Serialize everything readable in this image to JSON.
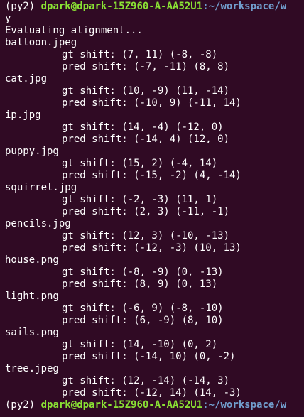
{
  "prompt_top": {
    "env": "(py2)",
    "user_host": "dpark@dpark-15Z960-A-AA52U1",
    "path": ":~/workspace/w"
  },
  "input_line": "y",
  "status": "Evaluating alignment...",
  "files": [
    {
      "name": "balloon.jpeg",
      "gt": "gt shift: (7, 11) (-8, -8)",
      "pred": "pred shift: (-7, -11) (8, 8)"
    },
    {
      "name": "cat.jpg",
      "gt": "gt shift: (10, -9) (11, -14)",
      "pred": "pred shift: (-10, 9) (-11, 14)"
    },
    {
      "name": "ip.jpg",
      "gt": "gt shift: (14, -4) (-12, 0)",
      "pred": "pred shift: (-14, 4) (12, 0)"
    },
    {
      "name": "puppy.jpg",
      "gt": "gt shift: (15, 2) (-4, 14)",
      "pred": "pred shift: (-15, -2) (4, -14)"
    },
    {
      "name": "squirrel.jpg",
      "gt": "gt shift: (-2, -3) (11, 1)",
      "pred": "pred shift: (2, 3) (-11, -1)"
    },
    {
      "name": "pencils.jpg",
      "gt": "gt shift: (12, 3) (-10, -13)",
      "pred": "pred shift: (-12, -3) (10, 13)"
    },
    {
      "name": "house.png",
      "gt": "gt shift: (-8, -9) (0, -13)",
      "pred": "pred shift: (8, 9) (0, 13)"
    },
    {
      "name": "light.png",
      "gt": "gt shift: (-6, 9) (-8, -10)",
      "pred": "pred shift: (6, -9) (8, 10)"
    },
    {
      "name": "sails.png",
      "gt": "gt shift: (14, -10) (0, 2)",
      "pred": "pred shift: (-14, 10) (0, -2)"
    },
    {
      "name": "tree.jpeg",
      "gt": "gt shift: (12, -14) (-14, 3)",
      "pred": "pred shift: (-12, 14) (14, -3)"
    }
  ],
  "prompt_bottom": {
    "env": "(py2)",
    "user_host": "dpark@dpark-15Z960-A-AA52U1",
    "path": ":~/workspace/w"
  },
  "colors": {
    "background": "#300a24",
    "user_host": "#8ae234",
    "path": "#729fcf",
    "text": "#ffffff"
  }
}
